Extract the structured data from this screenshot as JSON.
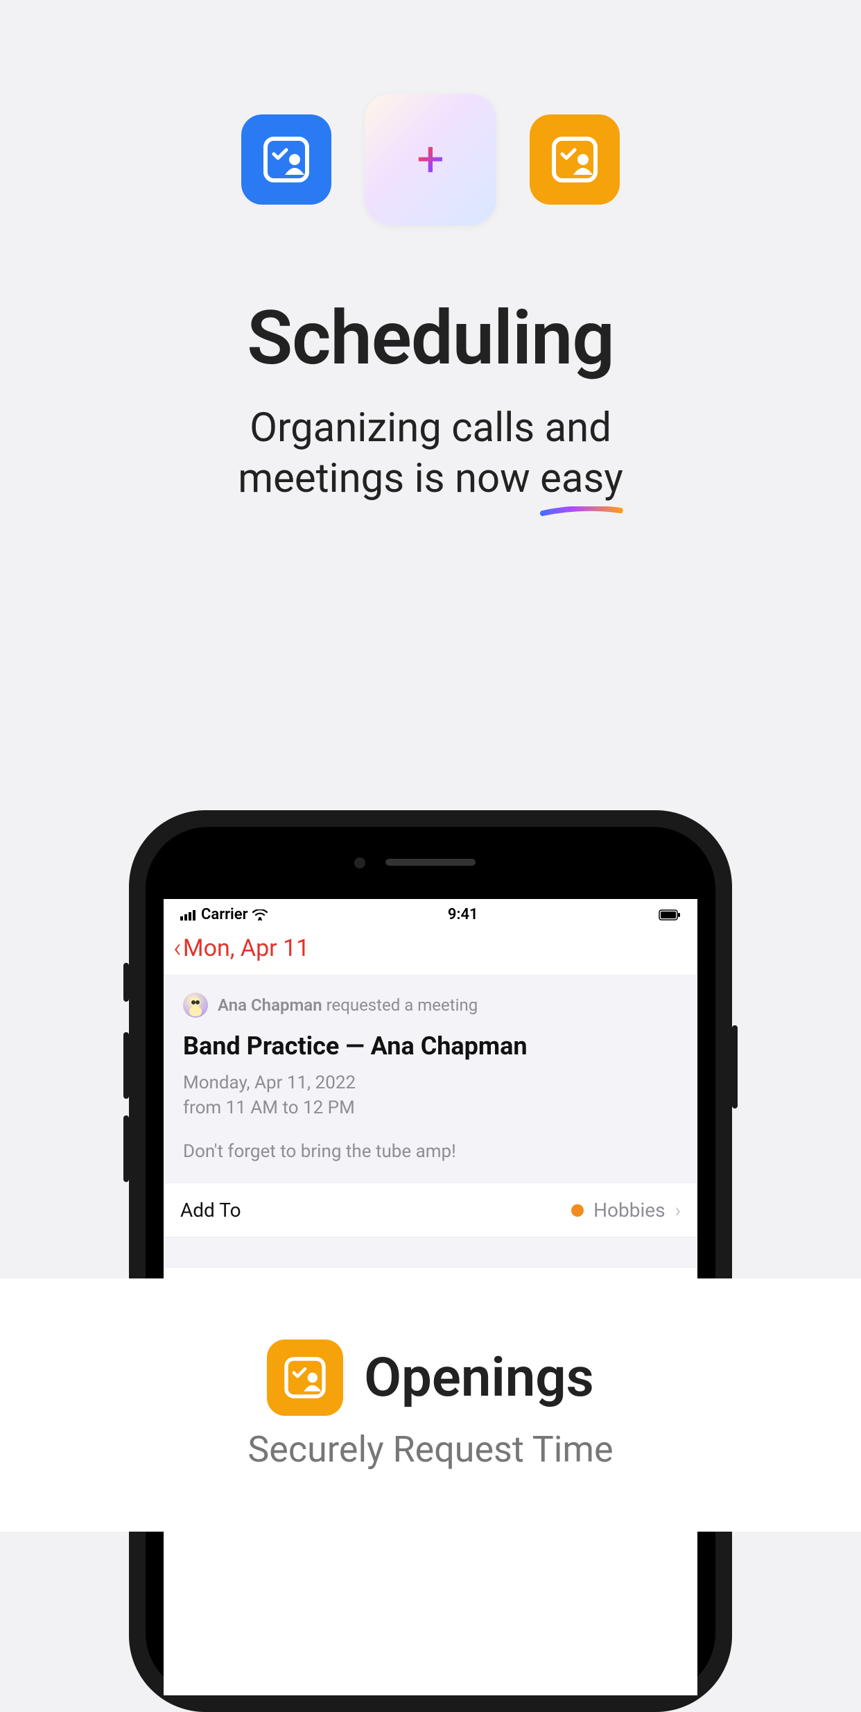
{
  "hero": {
    "title": "Scheduling",
    "subtitle_line1": "Organizing calls and",
    "subtitle_line2_prefix": "meetings is now ",
    "subtitle_emphasis": "easy"
  },
  "phone": {
    "status": {
      "carrier": "Carrier",
      "time": "9:41"
    },
    "nav": {
      "back_label": "Mon, Apr 11"
    },
    "card": {
      "requester_name": "Ana Chapman",
      "requester_action": " requested a meeting",
      "title": "Band Practice — Ana Chapman",
      "date": "Monday, Apr 11, 2022",
      "time": "from 11 AM to 12 PM",
      "note": "Don't forget to bring the tube amp!"
    },
    "addto": {
      "label": "Add To",
      "value": "Hobbies",
      "dot_color": "#f28c1e"
    },
    "contact": {
      "name": "Ana Chapman"
    }
  },
  "banner": {
    "title": "Openings",
    "subtitle": "Securely Request Time"
  }
}
